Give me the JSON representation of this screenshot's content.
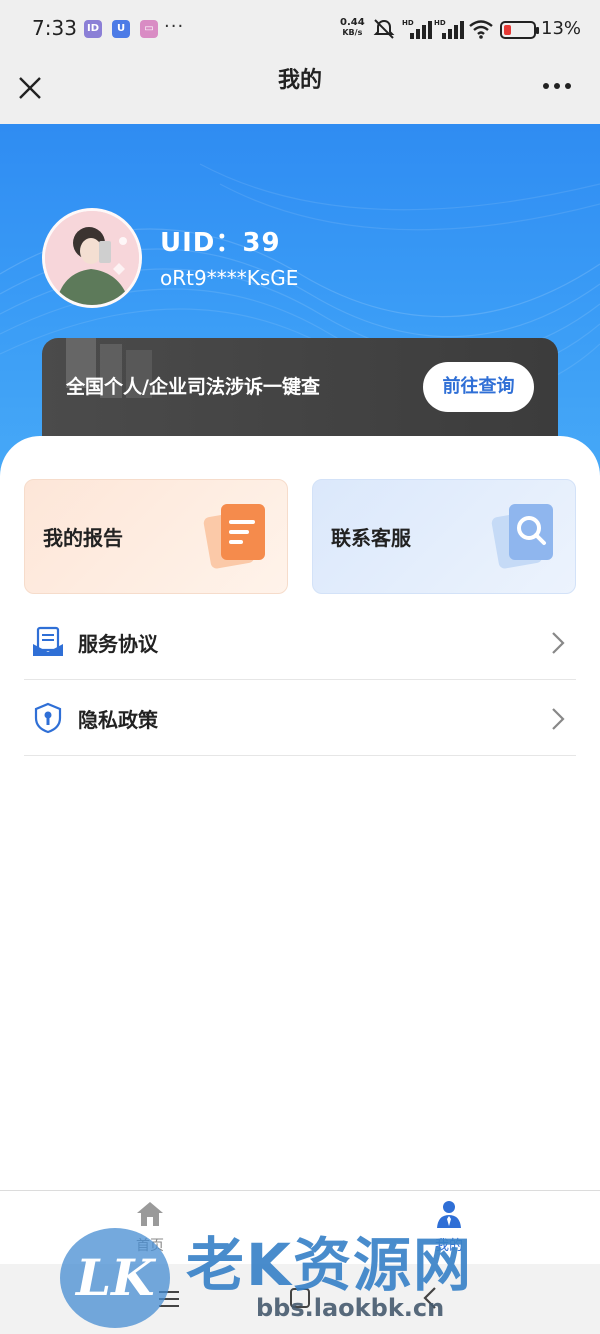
{
  "status_bar": {
    "time": "7:33",
    "app_icons": [
      "ID",
      "U",
      "▭"
    ],
    "more": "···",
    "net_speed_value": "0.44",
    "net_speed_unit": "KB/s",
    "battery_text": "13%",
    "battery_level": 0.13
  },
  "navbar": {
    "title": "我的",
    "close_icon": "close-icon",
    "more_icon": "more-icon"
  },
  "profile": {
    "uid": "UID：39",
    "openid_masked": "oRt9****KsGE"
  },
  "promo": {
    "text": "全国个人/企业司法涉诉一键查",
    "button_label": "前往查询"
  },
  "cards": [
    {
      "label": "我的报告",
      "icon": "report-icon"
    },
    {
      "label": "联系客服",
      "icon": "customer-service-icon"
    }
  ],
  "menu": [
    {
      "label": "服务协议",
      "icon": "agreement-icon"
    },
    {
      "label": "隐私政策",
      "icon": "privacy-shield-icon"
    }
  ],
  "tabbar": {
    "tabs": [
      {
        "label": "首页",
        "icon": "home-icon",
        "active": false
      },
      {
        "label": "我的",
        "icon": "user-icon",
        "active": true
      }
    ]
  },
  "watermark": {
    "logo_text": "LK",
    "brand": "老K资源网",
    "url": "bbs.laokbk.cn"
  },
  "colors": {
    "hero_blue": "#2f8cf2",
    "accent": "#2f6fd6",
    "battery_low": "#e53935"
  }
}
